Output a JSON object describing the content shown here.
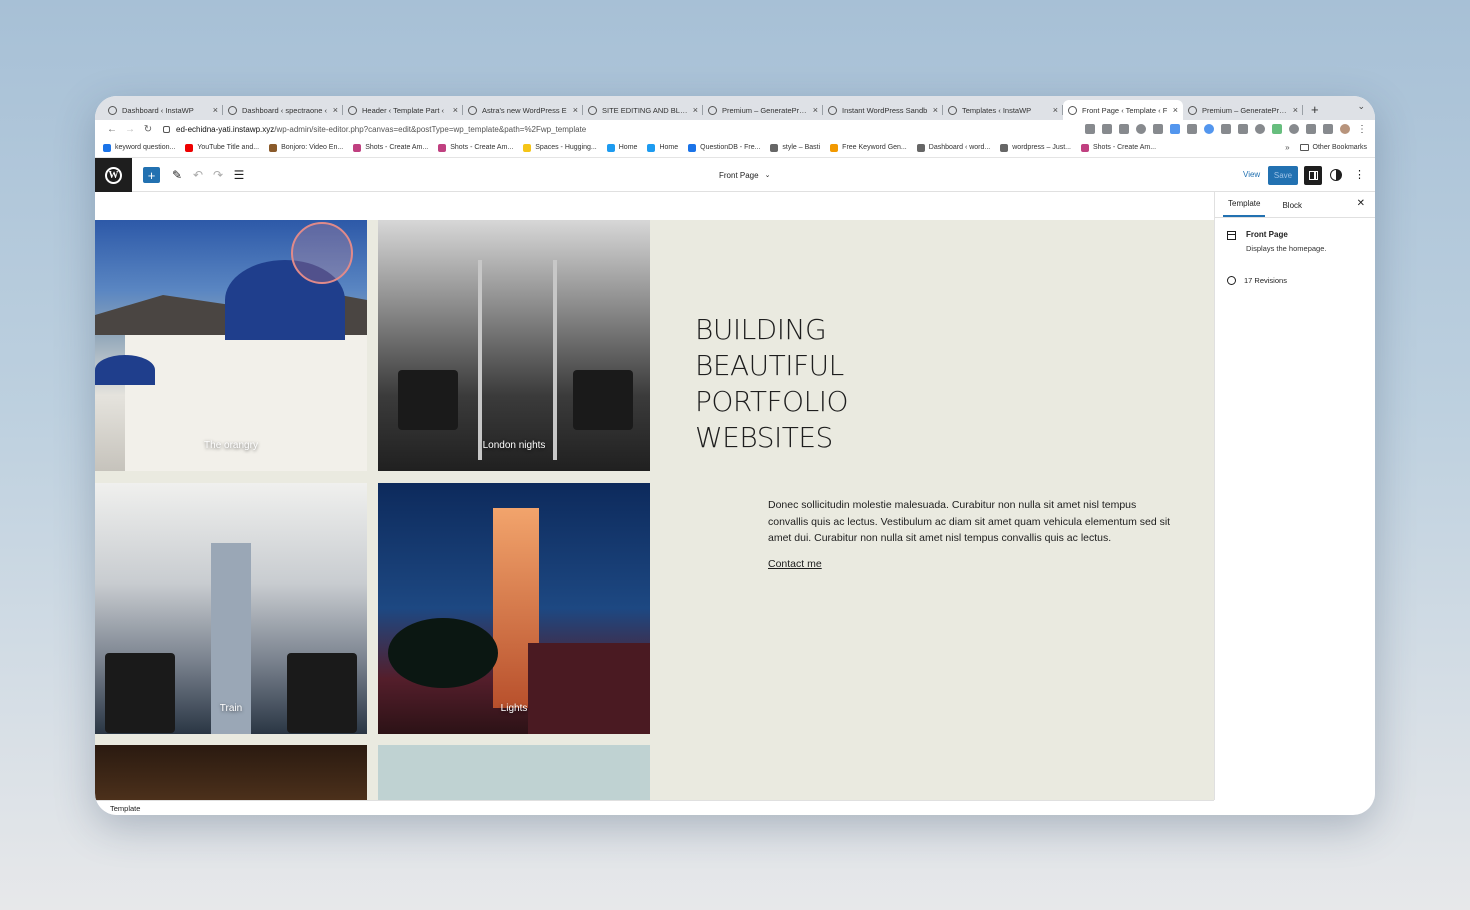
{
  "browser": {
    "tabs": [
      {
        "label": "Dashboard ‹ InstaWP",
        "active": false
      },
      {
        "label": "Dashboard ‹ spectraone ‹",
        "active": false
      },
      {
        "label": "Header ‹ Template Part ‹",
        "active": false
      },
      {
        "label": "Astra's new WordPress E",
        "active": false
      },
      {
        "label": "SITE EDITING AND BLOC",
        "active": false
      },
      {
        "label": "Premium – GeneratePress",
        "active": false
      },
      {
        "label": "Instant WordPress Sandb",
        "active": false
      },
      {
        "label": "Templates ‹ InstaWP",
        "active": false
      },
      {
        "label": "Front Page ‹ Template ‹ F",
        "active": true
      },
      {
        "label": "Premium – GeneratePress",
        "active": false
      }
    ],
    "new_tab": "+",
    "tab_menu": "⌄",
    "url_host": "ed-echidna-yati.instawp.xyz",
    "url_path": "/wp-admin/site-editor.php?canvas=edit&postType=wp_template&path=%2Fwp_template",
    "bookmarks": [
      "keyword question...",
      "YouTube Title and...",
      "Bonjoro: Video En...",
      "Shots - Create Am...",
      "Shots - Create Am...",
      "Spaces - Hugging...",
      "Home",
      "Home",
      "QuestionDB - Fre...",
      "style – Basti",
      "Free Keyword Gen...",
      "Dashboard ‹ word...",
      "wordpress – Just...",
      "Shots - Create Am..."
    ],
    "bookmarks_more": "»",
    "other_bookmarks": "Other Bookmarks"
  },
  "editor": {
    "doc_title": "Front Page",
    "view_label": "View",
    "save_label": "Save"
  },
  "canvas": {
    "photos": [
      {
        "caption": "The orangry"
      },
      {
        "caption": "London nights"
      },
      {
        "caption": "Train"
      },
      {
        "caption": "Lights"
      }
    ],
    "headline": [
      "BUILDING",
      "BEAUTIFUL",
      "PORTFOLIO",
      "WEBSITES"
    ],
    "body": "Donec sollicitudin molestie malesuada. Curabitur non nulla sit amet nisl tempus convallis quis ac lectus. Vestibulum ac diam sit amet quam vehicula elementum sed sit amet dui. Curabitur non nulla sit amet nisl tempus convallis quis ac lectus.",
    "contact": "Contact me"
  },
  "sidebar": {
    "tabs": [
      "Template",
      "Block"
    ],
    "template_name": "Front Page",
    "template_desc": "Displays the homepage.",
    "revisions": "17 Revisions"
  },
  "footer": {
    "breadcrumb": "Template"
  },
  "colors": {
    "accent": "#2271b1",
    "canvas_bg": "#eaeae0",
    "toolbar_dark": "#1e1e1e"
  }
}
